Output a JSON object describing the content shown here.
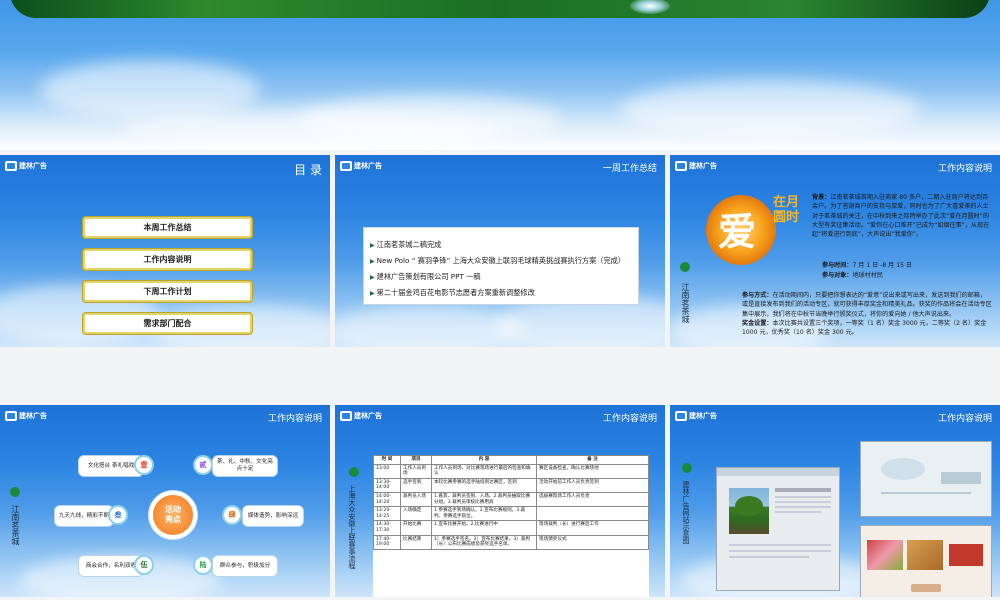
{
  "slides": {
    "s1": {
      "logo": "建林广告",
      "title": "目 录",
      "menu": [
        "本周工作总结",
        "工作内容说明",
        "下周工作计划",
        "需求部门配合"
      ]
    },
    "s2": {
      "logo": "建林广告",
      "title": "一周工作总结",
      "items": [
        "江南茗茶城二稿完成",
        "New Polo “ 赛羽争锋” 上海大众安徽上联羽毛球精英挑战赛执行方案（完成）",
        "建林广告策划有限公司 PPT 一稿",
        "第二十届金鸡百花电影节志愿者方案重新调整修改"
      ]
    },
    "s3": {
      "logo": "建林广告",
      "title": "工作内容说明",
      "side": "江南茗茶城",
      "ai": "爱",
      "calli": "在月圆时",
      "bg_label": "背景：",
      "bg_text": "江南茗茶城首期入驻商家 80 多户，二期入驻商户将达到百余户。为了答谢商户的支持与厚爱，同时也为了广大喜爱茶的人士对于茗茶城的关注，在中秋到来之际特举办了此次“爱在月圆时”的大型有奖征集活动。“爱你在心口难开”已成为“如烟往事”，从现在起“将爱进行到底”，大声说出“我爱你”。",
      "time_label": "参与时间：",
      "time": "7 月 1 日 -8 月 15 日",
      "target_label": "参与对象：",
      "target": "地球村村民",
      "method_label": "参与方式：",
      "method": "在活动期间内，只要把你想表达的“爱意”说出来或写出来，发送到我们的邮箱，或是直接发布到我们的活动专区，就可获得丰厚奖金和精美礼品。获奖的作品将会在活动专区集中展示，我们将在中秋节当晚举行颁奖仪式，将你的爱向她 / 他大声说出来。",
      "prize_label": "奖金设置：",
      "prize": "本次比赛共设置三个奖项，一等奖（1 名）奖金 3000 元，二等奖（2 名）奖金 1000 元，优秀奖（10 名）奖金 300 元。"
    },
    "s4": {
      "logo": "建林广告",
      "title": "工作内容说明",
      "side": "江南茗茶城",
      "hub": "活动\n亮点",
      "nodes": [
        {
          "n": "壹",
          "t": "文化搭台 茶礼唱戏"
        },
        {
          "n": "贰",
          "t": "茶、礼、中秋、文化亮点十足"
        },
        {
          "n": "叁",
          "t": "九天九线，精彩不断"
        },
        {
          "n": "肆",
          "t": "媒体造势，影响深远"
        },
        {
          "n": "伍",
          "t": "商会合作，名利双收"
        },
        {
          "n": "陆",
          "t": "群众参与，积极加分"
        }
      ]
    },
    "s5": {
      "logo": "建林广告",
      "title": "工作内容说明",
      "side": "上海大众安徽上联赛事流程",
      "headers": [
        "时 间",
        "项目",
        "内 容",
        "备 注"
      ],
      "rows": [
        [
          "13:00",
          "工作人员到场",
          "工作人员到场，对比赛现场进行最后的检查和确认",
          "赛区设备检查，确认比赛场地"
        ],
        [
          "13:30-14:00",
          "选手签到",
          "本轮比赛参赛的选手陆续到达赛区，签到",
          "活动开始前工作人员负责签到"
        ],
        [
          "14:00-14:20",
          "裁判员入场",
          "1.嘉宾、裁判员签到、入场。2.裁判员抽取比赛分组。3.裁判员审核比赛用具",
          "选拔赛现场工作人员负责"
        ],
        [
          "13:20-14:25",
          "入场确定",
          "1.参赛选手到场确认。2.宣布比赛规则。3.裁判、参赛选手就位。",
          ""
        ],
        [
          "14:30-17:30",
          "开始比赛",
          "1.宣布比赛开始。2.比赛进行中",
          "现场裁判（长）进行赛后工作"
        ],
        [
          "17:40-19:00",
          "比赛结束",
          "1）参赛选手签名。2）宣布比赛结果。3）裁判（长）公布比赛成绩及获奖选手名单。",
          "现场颁奖仪式"
        ]
      ]
    },
    "s6": {
      "logo": "建林广告",
      "title": "工作内容说明",
      "side": "建林广告网站示意图"
    }
  }
}
